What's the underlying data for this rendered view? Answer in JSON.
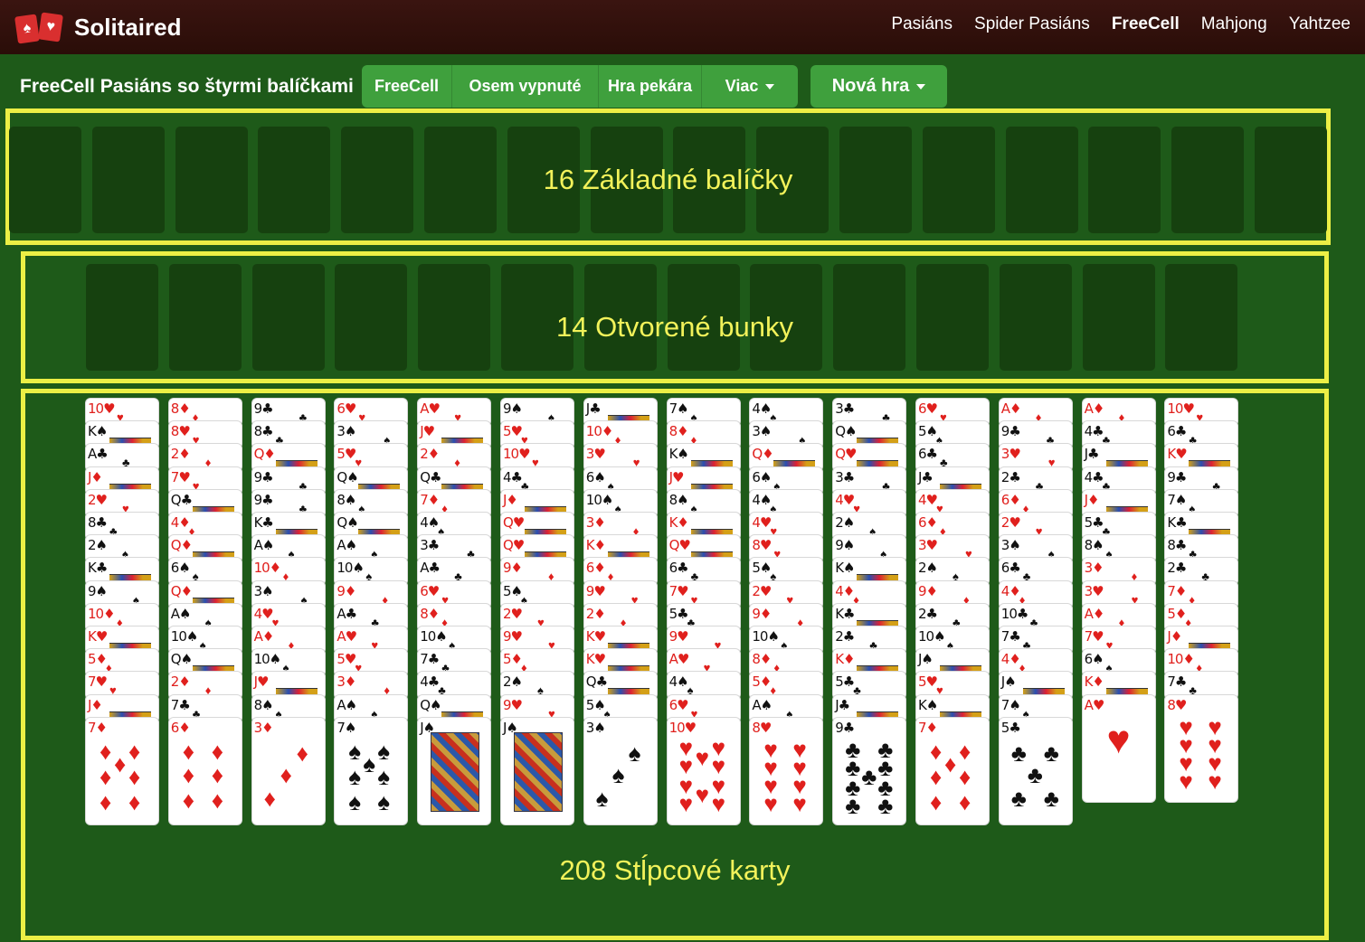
{
  "nav": {
    "brand": "Solitaired",
    "links": [
      "Pasiáns",
      "Spider Pasiáns",
      "FreeCell",
      "Mahjong",
      "Yahtzee"
    ],
    "active_link": "FreeCell"
  },
  "subbar": {
    "title": "FreeCell Pasiáns so štyrmi balíčkami",
    "variant_buttons": [
      "FreeCell",
      "Osem vypnuté",
      "Hra pekára",
      "Viac"
    ],
    "new_game": "Nová hra"
  },
  "foundations": {
    "label": "16 Základné balíčky",
    "slot_count": 16
  },
  "free_cells": {
    "label": "14 Otvorené bunky",
    "slot_count": 14
  },
  "tableau": {
    "label": "208 Stĺpcové karty",
    "columns": [
      [
        "10♥",
        "K♠",
        "A♣",
        "J♦",
        "2♥",
        "8♣",
        "2♠",
        "K♣",
        "9♠",
        "10♦",
        "K♥",
        "5♦",
        "7♥",
        "J♦",
        "7♦"
      ],
      [
        "8♦",
        "8♥",
        "2♦",
        "7♥",
        "Q♣",
        "4♦",
        "Q♦",
        "6♠",
        "Q♦",
        "A♠",
        "10♠",
        "Q♠",
        "2♦",
        "7♣",
        "6♦"
      ],
      [
        "9♣",
        "8♣",
        "Q♦",
        "9♣",
        "9♣",
        "K♣",
        "A♠",
        "10♦",
        "3♠",
        "4♥",
        "A♦",
        "10♠",
        "J♥",
        "8♠",
        "3♦"
      ],
      [
        "6♥",
        "3♠",
        "5♥",
        "Q♠",
        "8♠",
        "Q♠",
        "A♠",
        "10♠",
        "9♦",
        "A♣",
        "A♥",
        "5♥",
        "3♦",
        "A♠",
        "7♠"
      ],
      [
        "A♥",
        "J♥",
        "2♦",
        "Q♣",
        "7♦",
        "4♠",
        "3♣",
        "A♣",
        "6♥",
        "8♦",
        "10♠",
        "7♣",
        "4♣",
        "Q♠",
        "J♠"
      ],
      [
        "9♠",
        "5♥",
        "10♥",
        "4♣",
        "J♦",
        "Q♥",
        "Q♥",
        "9♦",
        "5♠",
        "2♥",
        "9♥",
        "5♦",
        "2♠",
        "9♥",
        "J♠"
      ],
      [
        "J♣",
        "10♦",
        "3♥",
        "6♠",
        "10♠",
        "3♦",
        "K♦",
        "6♦",
        "9♥",
        "2♦",
        "K♥",
        "K♥",
        "Q♣",
        "5♠",
        "3♠"
      ],
      [
        "7♠",
        "8♦",
        "K♠",
        "J♥",
        "8♠",
        "K♦",
        "Q♥",
        "6♣",
        "7♥",
        "5♣",
        "9♥",
        "A♥",
        "4♠",
        "6♥",
        "10♥"
      ],
      [
        "4♠",
        "3♠",
        "Q♦",
        "6♠",
        "4♠",
        "4♥",
        "8♥",
        "5♠",
        "2♥",
        "9♦",
        "10♠",
        "8♦",
        "5♦",
        "A♠",
        "8♥"
      ],
      [
        "3♣",
        "Q♠",
        "Q♥",
        "3♣",
        "4♥",
        "2♠",
        "9♠",
        "K♠",
        "4♦",
        "K♣",
        "2♣",
        "K♦",
        "5♣",
        "J♣",
        "9♣"
      ],
      [
        "6♥",
        "5♠",
        "6♣",
        "J♣",
        "4♥",
        "6♦",
        "3♥",
        "2♠",
        "9♦",
        "2♣",
        "10♠",
        "J♠",
        "5♥",
        "K♠",
        "7♦"
      ],
      [
        "A♦",
        "9♣",
        "3♥",
        "2♣",
        "6♦",
        "2♥",
        "3♠",
        "6♣",
        "4♦",
        "10♣",
        "7♣",
        "4♦",
        "J♠",
        "7♠",
        "5♣"
      ],
      [
        "A♦",
        "4♣",
        "J♣",
        "4♣",
        "J♦",
        "5♣",
        "8♠",
        "3♦",
        "3♥",
        "A♦",
        "7♥",
        "6♠",
        "K♦",
        "A♥"
      ],
      [
        "10♥",
        "6♣",
        "K♥",
        "9♣",
        "7♠",
        "K♣",
        "8♣",
        "2♣",
        "7♦",
        "5♦",
        "J♦",
        "10♦",
        "7♣",
        "8♥"
      ]
    ]
  },
  "colors": {
    "felt": "#1e5a19",
    "slot": "#16410f",
    "highlight": "#ecef45",
    "button": "#3fa03d",
    "navbar": "#2f0f0b",
    "red_suit": "#e0201d"
  }
}
